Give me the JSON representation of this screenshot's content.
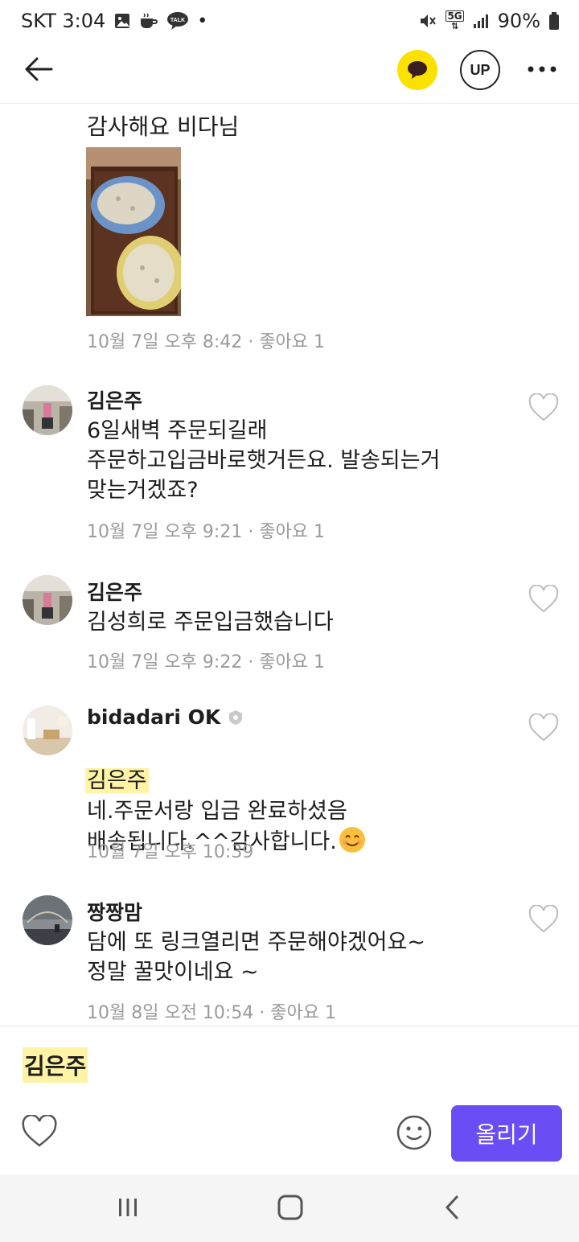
{
  "status_bar": {
    "carrier_time": "SKT 3:04",
    "network": "5G",
    "battery": "90%"
  },
  "top_bar": {
    "up_label": "UP"
  },
  "content": {
    "partial_text": "감사해요 비다님",
    "photo_meta": "10월 7일 오후 8:42 · 좋아요 1",
    "comments": [
      {
        "author": "김은주",
        "text": "6일새벽 주문되길래\n주문하고입금바로햇거든요.  발송되는거\n맞는거겠죠?",
        "meta": "10월 7일 오후 9:21 · 좋아요 1"
      },
      {
        "author": "김은주",
        "text": "김성희로 주문입금했습니다",
        "meta": "10월 7일 오후 9:22 · 좋아요 1"
      },
      {
        "author": "bidadari OK",
        "mention": "김은주",
        "text": "네.주문서랑 입금 완료하셨음\n배송됩니다.^^감사합니다.",
        "meta": "10월 7일 오후 10:39"
      },
      {
        "author": "짱짱맘",
        "text": "담에 또 링크열리면 주문해야겠어요~\n정말 꿀맛이네요 ~",
        "meta": "10월 8일 오전 10:54 · 좋아요 1"
      }
    ]
  },
  "input_bar": {
    "mention": "김은주",
    "submit_label": "올리기"
  },
  "colors": {
    "kakao_yellow": "#fae100",
    "submit_purple": "#6a4df4",
    "mention_highlight": "#fff3a6"
  }
}
